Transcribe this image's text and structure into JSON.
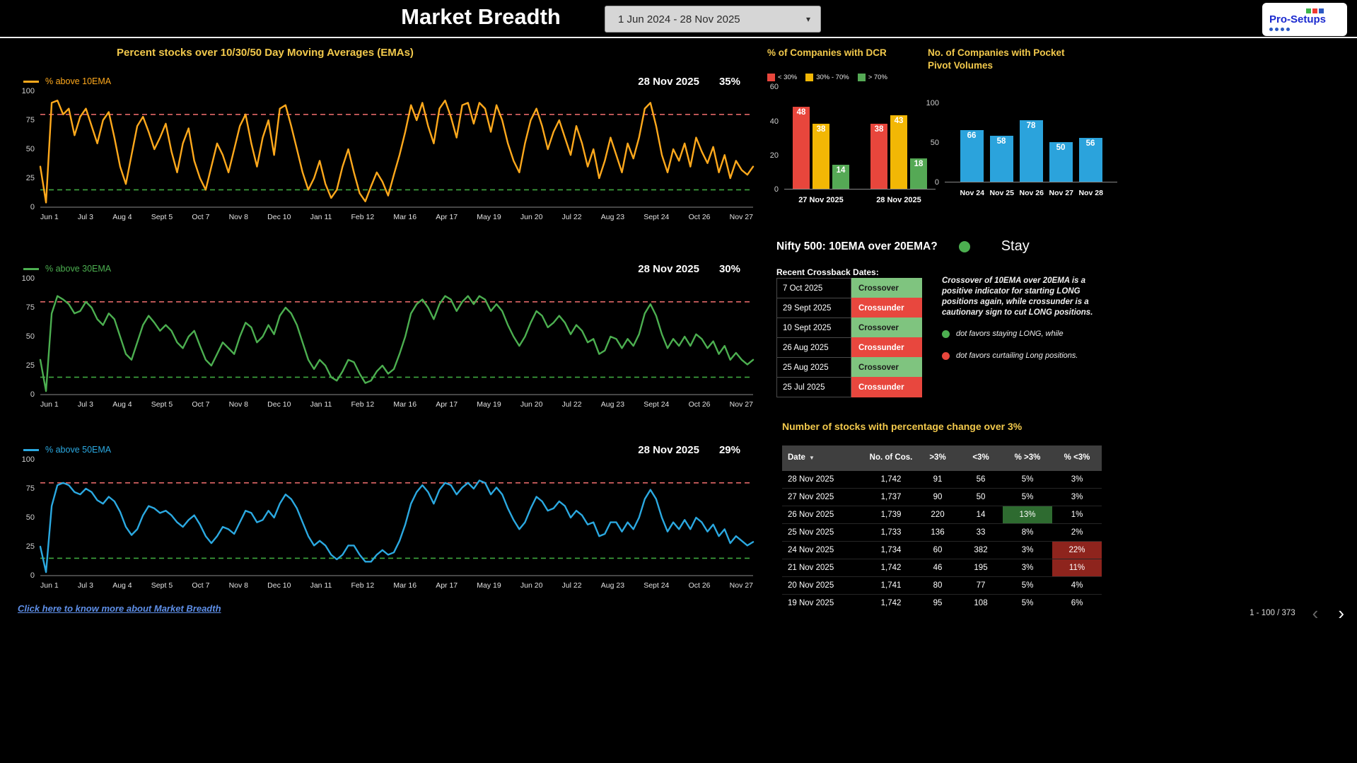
{
  "header": {
    "title": "Market Breadth",
    "date_range": "1 Jun 2024 - 28 Nov 2025",
    "logo_text": "Pro-Setups"
  },
  "ema_section": {
    "link_text": "Click here to know more about Market Breadth"
  },
  "nifty_signal": {
    "question": "Nifty 500: 10EMA over 20EMA?",
    "status": "Stay"
  },
  "crossback": {
    "title": "Recent Crossback Dates:",
    "rows": [
      {
        "date": "7 Oct 2025",
        "status": "Crossover"
      },
      {
        "date": "29 Sept 2025",
        "status": "Crossunder"
      },
      {
        "date": "10 Sept 2025",
        "status": "Crossover"
      },
      {
        "date": "26 Aug 2025",
        "status": "Crossunder"
      },
      {
        "date": "25 Aug 2025",
        "status": "Crossover"
      },
      {
        "date": "25 Jul 2025",
        "status": "Crossunder"
      }
    ],
    "note": "Crossover of 10EMA over 20EMA is a positive indicator for starting LONG positions again, while crossunder is a cautionary sign to cut LONG positions.",
    "green_bullet": "dot favors staying LONG, while",
    "red_bullet": "dot favors curtailing Long positions."
  },
  "pct_change_table": {
    "title": "Number of stocks with percentage change over 3%",
    "headers": [
      "Date",
      "No. of Cos.",
      ">3%",
      "<3%",
      "% >3%",
      "% <3%"
    ],
    "rows": [
      [
        "28 Nov 2025",
        "1,742",
        "91",
        "56",
        "5%",
        "3%"
      ],
      [
        "27 Nov 2025",
        "1,737",
        "90",
        "50",
        "5%",
        "3%"
      ],
      [
        "26 Nov 2025",
        "1,739",
        "220",
        "14",
        "13%",
        "1%"
      ],
      [
        "25 Nov 2025",
        "1,733",
        "136",
        "33",
        "8%",
        "2%"
      ],
      [
        "24 Nov 2025",
        "1,734",
        "60",
        "382",
        "3%",
        "22%"
      ],
      [
        "21 Nov 2025",
        "1,742",
        "46",
        "195",
        "3%",
        "11%"
      ],
      [
        "20 Nov 2025",
        "1,741",
        "80",
        "77",
        "5%",
        "4%"
      ],
      [
        "19 Nov 2025",
        "1,742",
        "95",
        "108",
        "5%",
        "6%"
      ]
    ],
    "highlights": {
      "2-4": "green",
      "4-5": "red",
      "5-5": "red"
    },
    "pagination": "1 - 100 / 373"
  },
  "chart_data": [
    {
      "type": "line",
      "title": "Percent stocks over 10/30/50 Day Moving Averages (EMAs)",
      "ylim": [
        0,
        100
      ],
      "y_ticks": [
        100,
        75,
        50,
        25,
        0
      ],
      "thresholds": [
        {
          "y": 80,
          "color": "#e06666"
        },
        {
          "y": 15,
          "color": "#3fa73f"
        }
      ],
      "x_tick_labels": [
        "Jun 1",
        "Jul 3",
        "Aug 4",
        "Sept 5",
        "Oct 7",
        "Nov 8",
        "Dec 10",
        "Jan 11",
        "Feb 12",
        "Mar 16",
        "Apr 17",
        "May 19",
        "Jun 20",
        "Jul 22",
        "Aug 23",
        "Sept 24",
        "Oct 26",
        "Nov 27"
      ],
      "series": [
        {
          "name": "% above 10EMA",
          "color": "#ffa91c",
          "last_date": "28 Nov 2025",
          "last_value": "35%",
          "values": [
            35,
            4,
            90,
            92,
            80,
            85,
            62,
            78,
            85,
            70,
            55,
            75,
            82,
            60,
            35,
            20,
            45,
            70,
            78,
            65,
            50,
            60,
            72,
            48,
            30,
            55,
            68,
            40,
            25,
            15,
            35,
            55,
            45,
            30,
            50,
            70,
            80,
            55,
            35,
            60,
            75,
            45,
            85,
            88,
            70,
            50,
            30,
            15,
            25,
            40,
            20,
            8,
            15,
            35,
            50,
            30,
            12,
            5,
            18,
            30,
            22,
            10,
            28,
            45,
            65,
            88,
            75,
            90,
            70,
            55,
            85,
            92,
            78,
            60,
            88,
            90,
            72,
            90,
            85,
            65,
            88,
            75,
            55,
            40,
            30,
            55,
            75,
            85,
            70,
            50,
            65,
            75,
            60,
            45,
            70,
            55,
            35,
            50,
            25,
            40,
            60,
            45,
            30,
            55,
            42,
            60,
            85,
            90,
            70,
            45,
            30,
            50,
            40,
            55,
            35,
            60,
            48,
            38,
            52,
            30,
            45,
            25,
            40,
            32,
            28,
            35
          ]
        },
        {
          "name": "% above 30EMA",
          "color": "#4caf50",
          "last_date": "28 Nov 2025",
          "last_value": "30%",
          "values": [
            30,
            3,
            70,
            85,
            82,
            78,
            70,
            72,
            80,
            75,
            65,
            60,
            70,
            65,
            50,
            35,
            30,
            45,
            60,
            68,
            62,
            55,
            60,
            55,
            45,
            40,
            50,
            55,
            42,
            30,
            25,
            35,
            45,
            40,
            35,
            50,
            62,
            58,
            45,
            50,
            60,
            52,
            68,
            75,
            70,
            60,
            45,
            30,
            22,
            30,
            25,
            15,
            12,
            20,
            30,
            28,
            18,
            10,
            12,
            20,
            25,
            18,
            22,
            35,
            50,
            70,
            78,
            82,
            75,
            65,
            78,
            85,
            82,
            72,
            80,
            85,
            78,
            85,
            82,
            72,
            78,
            72,
            60,
            50,
            42,
            50,
            62,
            72,
            68,
            58,
            62,
            68,
            62,
            52,
            60,
            55,
            45,
            48,
            35,
            38,
            50,
            48,
            40,
            48,
            42,
            52,
            70,
            78,
            68,
            52,
            40,
            48,
            42,
            50,
            42,
            52,
            48,
            40,
            46,
            35,
            42,
            30,
            36,
            30,
            26,
            30
          ]
        },
        {
          "name": "% above 50EMA",
          "color": "#2ba9e1",
          "last_date": "28 Nov 2025",
          "last_value": "29%",
          "values": [
            25,
            3,
            60,
            78,
            80,
            78,
            72,
            70,
            75,
            72,
            65,
            62,
            68,
            64,
            55,
            42,
            35,
            40,
            52,
            60,
            58,
            54,
            56,
            52,
            46,
            42,
            48,
            52,
            44,
            34,
            28,
            34,
            42,
            40,
            36,
            46,
            56,
            54,
            46,
            48,
            56,
            50,
            62,
            70,
            66,
            58,
            46,
            34,
            26,
            30,
            26,
            18,
            14,
            18,
            26,
            26,
            18,
            12,
            12,
            18,
            22,
            18,
            20,
            30,
            44,
            62,
            72,
            78,
            72,
            62,
            74,
            80,
            78,
            70,
            76,
            80,
            75,
            82,
            80,
            70,
            76,
            70,
            58,
            48,
            40,
            46,
            58,
            68,
            64,
            56,
            58,
            64,
            60,
            50,
            56,
            52,
            44,
            46,
            34,
            36,
            46,
            46,
            38,
            46,
            40,
            50,
            66,
            74,
            66,
            50,
            38,
            46,
            40,
            48,
            40,
            50,
            46,
            38,
            44,
            34,
            40,
            28,
            34,
            30,
            26,
            29
          ]
        }
      ]
    },
    {
      "type": "bar",
      "title": "% of Companies with DCR",
      "ylim": [
        0,
        60
      ],
      "y_ticks": [
        60,
        40,
        20,
        0
      ],
      "categories": [
        "27 Nov 2025",
        "28 Nov 2025"
      ],
      "series": [
        {
          "name": "< 30%",
          "color": "#e8463c",
          "values": [
            48,
            38
          ]
        },
        {
          "name": "30% - 70%",
          "color": "#f2b705",
          "values": [
            38,
            43
          ]
        },
        {
          "name": "> 70%",
          "color": "#55a955",
          "values": [
            14,
            18
          ]
        }
      ]
    },
    {
      "type": "bar",
      "title": "No. of Companies with Pocket Pivot Volumes",
      "ylim": [
        0,
        100
      ],
      "y_ticks": [
        100,
        50,
        0
      ],
      "color": "#2ba3dc",
      "categories": [
        "Nov 24",
        "Nov 25",
        "Nov 26",
        "Nov 27",
        "Nov 28"
      ],
      "values": [
        66,
        58,
        78,
        50,
        56
      ]
    }
  ]
}
